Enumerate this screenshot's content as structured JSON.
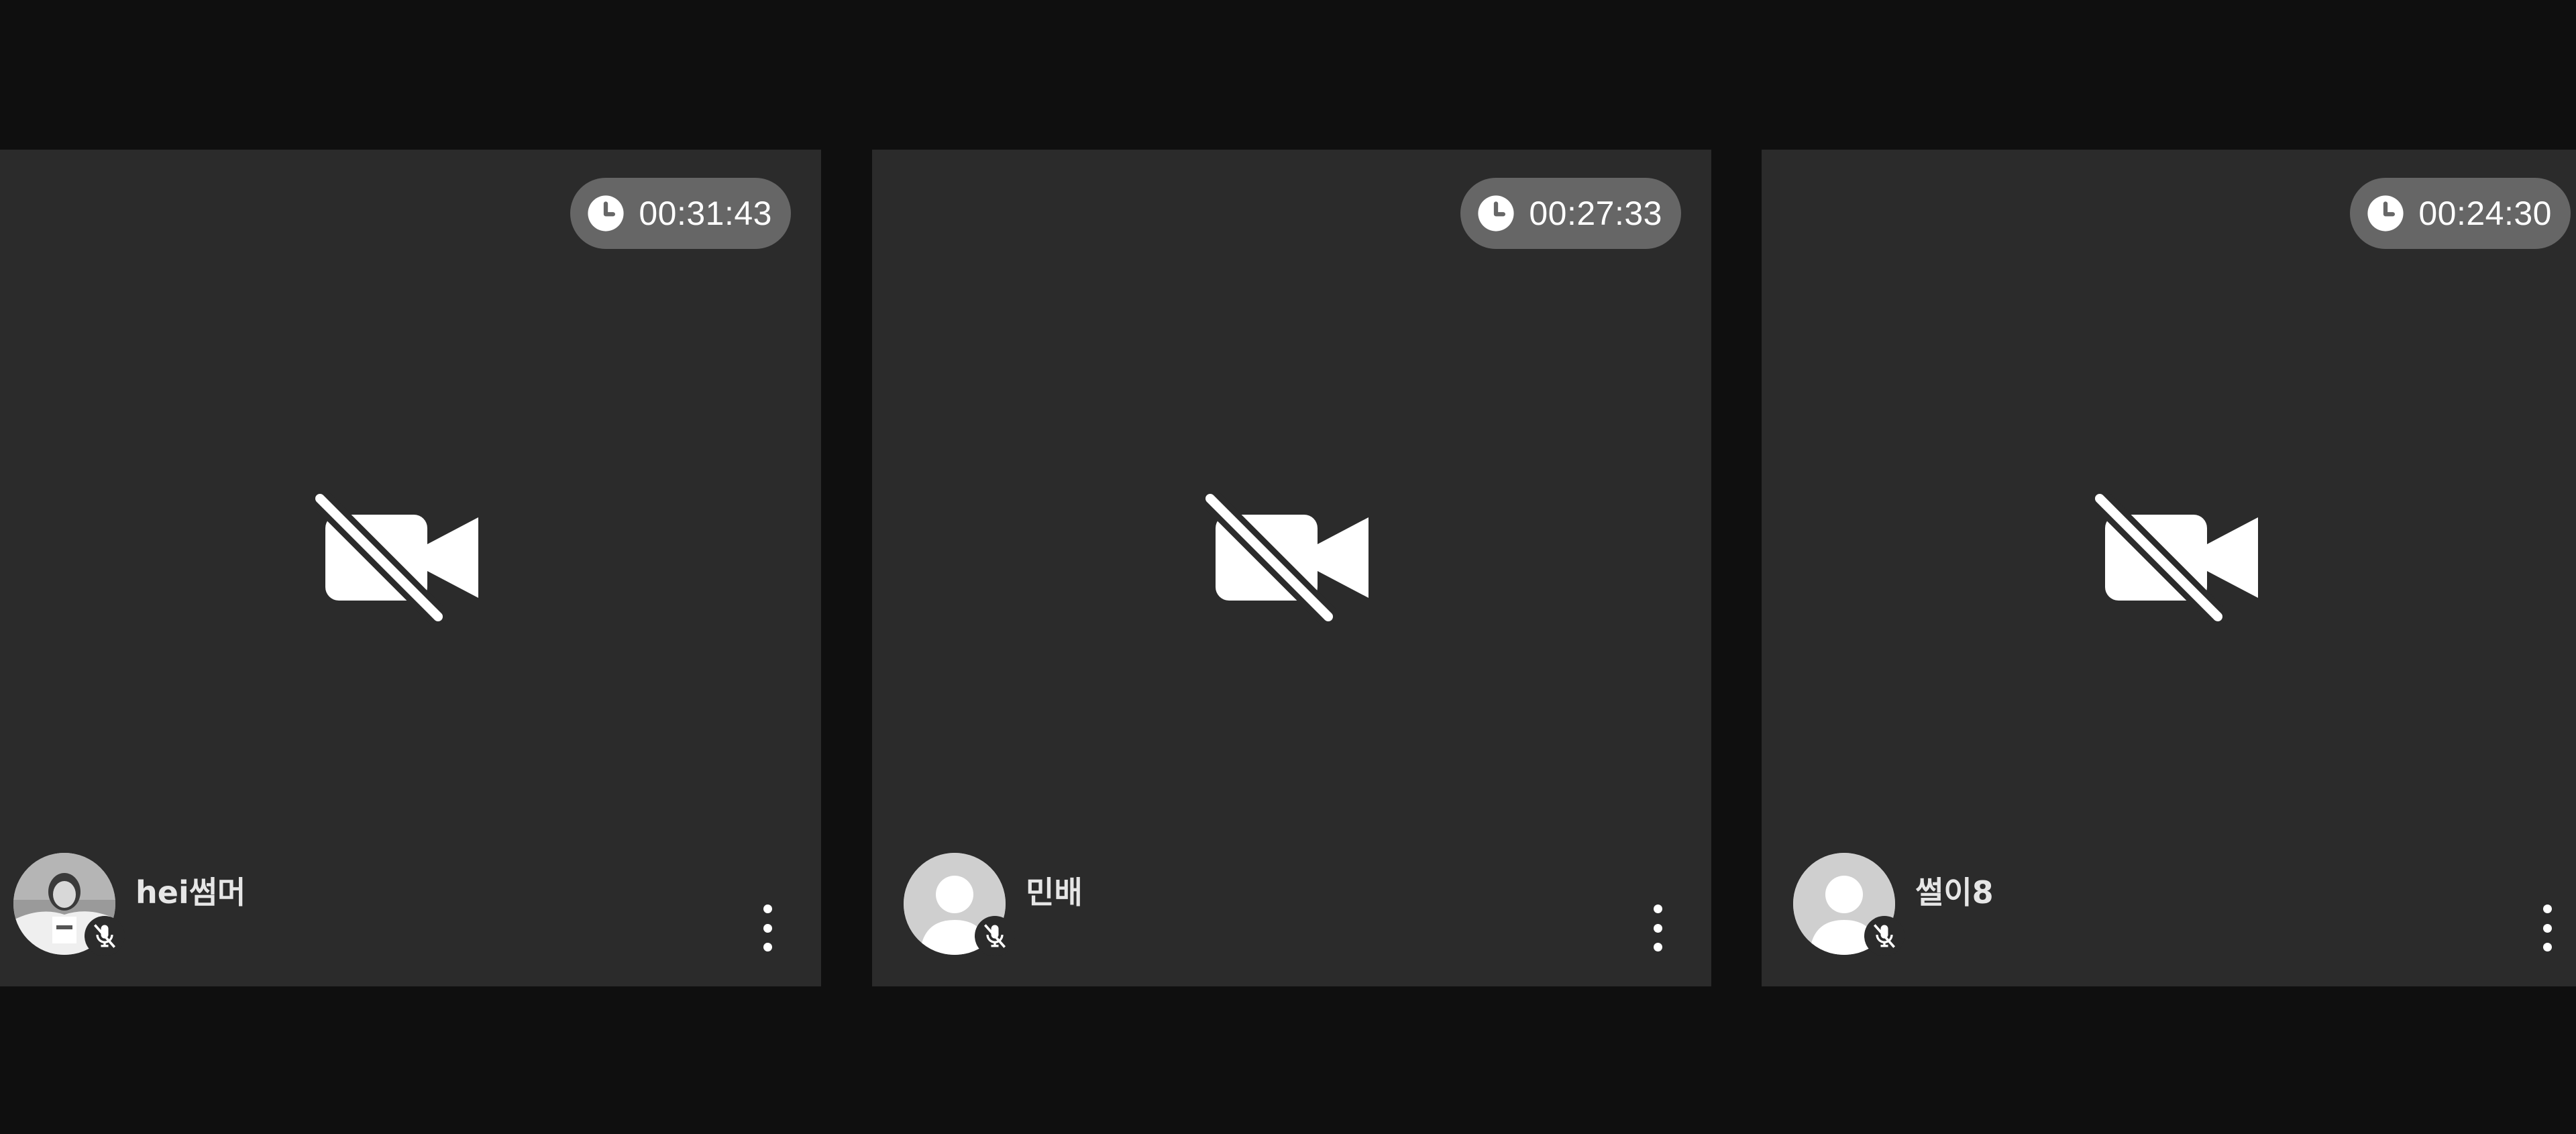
{
  "participants": [
    {
      "name": "hei썸머",
      "elapsed": "00:31:43",
      "avatar": "photo",
      "video": "off",
      "mic": "muted"
    },
    {
      "name": "민배",
      "elapsed": "00:27:33",
      "avatar": "default-silhouette",
      "video": "off",
      "mic": "muted"
    },
    {
      "name": "썰이8",
      "elapsed": "00:24:30",
      "avatar": "default-silhouette",
      "video": "off",
      "mic": "muted"
    }
  ],
  "icons": {
    "timer": "clock-icon",
    "video_state": "video-off-icon",
    "mic_state": "mic-off-icon",
    "menu": "more-vertical-icon"
  },
  "colors": {
    "background": "#0f0f0f",
    "tile": "#2b2b2b",
    "timer_pill": "#666666",
    "text": "#ffffff"
  }
}
